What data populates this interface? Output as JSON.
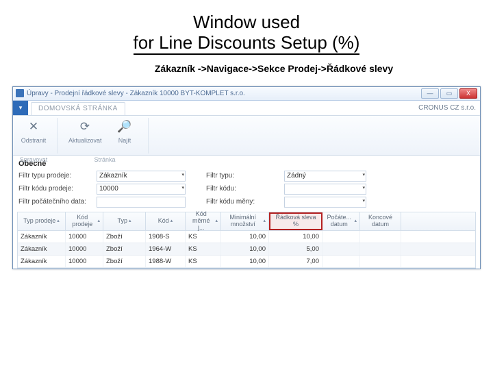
{
  "slide": {
    "title_line1": "Window used",
    "title_line2": "for Line Discounts Setup (%)",
    "breadcrumb": "Zákazník  ->Navigace->Sekce Prodej->Řádkové slevy"
  },
  "window": {
    "title": "Úpravy - Prodejní řádkové slevy - Zákazník 10000 BYT-KOMPLET s.r.o.",
    "min": "—",
    "max": "▭",
    "close": "X",
    "company": "CRONUS CZ s.r.o."
  },
  "ribbon": {
    "toggle": "▾",
    "tab": "DOMOVSKÁ STRÁNKA",
    "buttons": {
      "delete": {
        "icon": "✕",
        "label": "Odstranit"
      },
      "refresh": {
        "icon": "⟳",
        "label": "Aktualizovat"
      },
      "find": {
        "icon": "🔎",
        "label": "Najít"
      }
    },
    "groups": {
      "manage": "Spravovat",
      "page": "Stránka"
    }
  },
  "section": {
    "general": "Obecné"
  },
  "filters": {
    "left": {
      "f1": {
        "label": "Filtr typu prodeje:",
        "value": "Zákazník"
      },
      "f2": {
        "label": "Filtr kódu prodeje:",
        "value": "10000"
      },
      "f3": {
        "label": "Filtr počátečního data:",
        "value": ""
      }
    },
    "right": {
      "f1": {
        "label": "Filtr typu:",
        "value": "Žádný"
      },
      "f2": {
        "label": "Filtr kódu:",
        "value": ""
      },
      "f3": {
        "label": "Filtr kódu měny:",
        "value": ""
      }
    }
  },
  "columns": {
    "c0": "Typ prodeje",
    "c1": "Kód prodeje",
    "c2": "Typ",
    "c3": "Kód",
    "c4": "Kód měrné j...",
    "c5": "Minimální množství",
    "c6": "Řádková sleva %",
    "c7": "Počáte... datum",
    "c8": "Koncové datum"
  },
  "rows": [
    {
      "c0": "Zákazník",
      "c1": "10000",
      "c2": "Zboží",
      "c3": "1908-S",
      "c4": "KS",
      "c5": "10,00",
      "c6": "10,00",
      "c7": "",
      "c8": ""
    },
    {
      "c0": "Zákazník",
      "c1": "10000",
      "c2": "Zboží",
      "c3": "1964-W",
      "c4": "KS",
      "c5": "10,00",
      "c6": "5,00",
      "c7": "",
      "c8": ""
    },
    {
      "c0": "Zákazník",
      "c1": "10000",
      "c2": "Zboží",
      "c3": "1988-W",
      "c4": "KS",
      "c5": "10,00",
      "c6": "7,00",
      "c7": "",
      "c8": ""
    }
  ]
}
